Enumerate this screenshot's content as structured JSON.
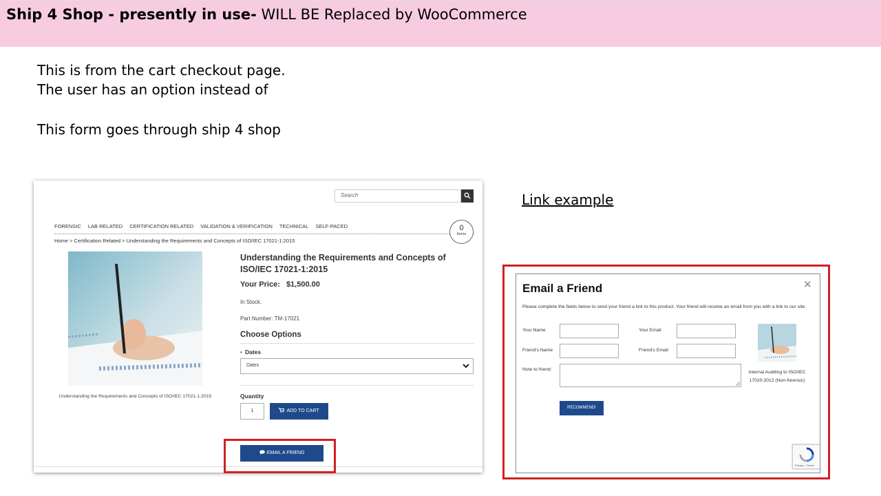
{
  "slide": {
    "title_bold": "Ship 4 Shop - presently in use-",
    "title_rest": "WILL BE Replaced by WooCommerce",
    "notes": [
      "This is from the cart checkout page.",
      "The user has an option instead of",
      "This form goes through ship 4 shop"
    ],
    "link_example": "Link example"
  },
  "product_page": {
    "search_placeholder": "Search",
    "nav": [
      "FORENSIC",
      "LAB RELATED",
      "CERTIFICATION RELATED",
      "VALIDATION & VERIFICATION",
      "TECHNICAL",
      "SELF-PACED"
    ],
    "cart_count": "0",
    "cart_items_label": "Items",
    "breadcrumb": "Home > Certification Related > Understanding the Requirements and Concepts of ISO/IEC 17021-1:2015",
    "product_caption": "Understanding the Requirements and Concepts of ISO/IEC 17021-1:2015",
    "title": "Understanding the Requirements and Concepts of ISO/IEC 17021-1:2015",
    "price_label": "Your Price:",
    "price_value": "$1,500.00",
    "stock": "In Stock.",
    "part_number": "Part Number: TM-17021",
    "choose_options": "Choose Options",
    "dates_label": "Dates",
    "dates_selected": "Dates",
    "quantity_label": "Quantity",
    "quantity_value": "1",
    "add_to_cart": "ADD TO CART",
    "email_friend": "EMAIL A FRIEND"
  },
  "email_dialog": {
    "title": "Email a Friend",
    "description": "Please complete the fields below to send your friend a link to this product. Your friend will receive an email from you with a link to our site.",
    "your_name": "Your Name",
    "your_email": "Your Email",
    "friends_name": "Friend's Name",
    "friends_email": "Friend's Email",
    "note": "Note to friend:",
    "product_name": "Internal Auditing to ISO/IEC 17020:2012 (Non-forensic)",
    "recommend": "RECOMMEND!",
    "recaptcha_text": "Privacy - Terms"
  },
  "colors": {
    "header_band": "#f7cce0",
    "button_blue": "#1e4a8c",
    "highlight_red": "#d01f24"
  }
}
